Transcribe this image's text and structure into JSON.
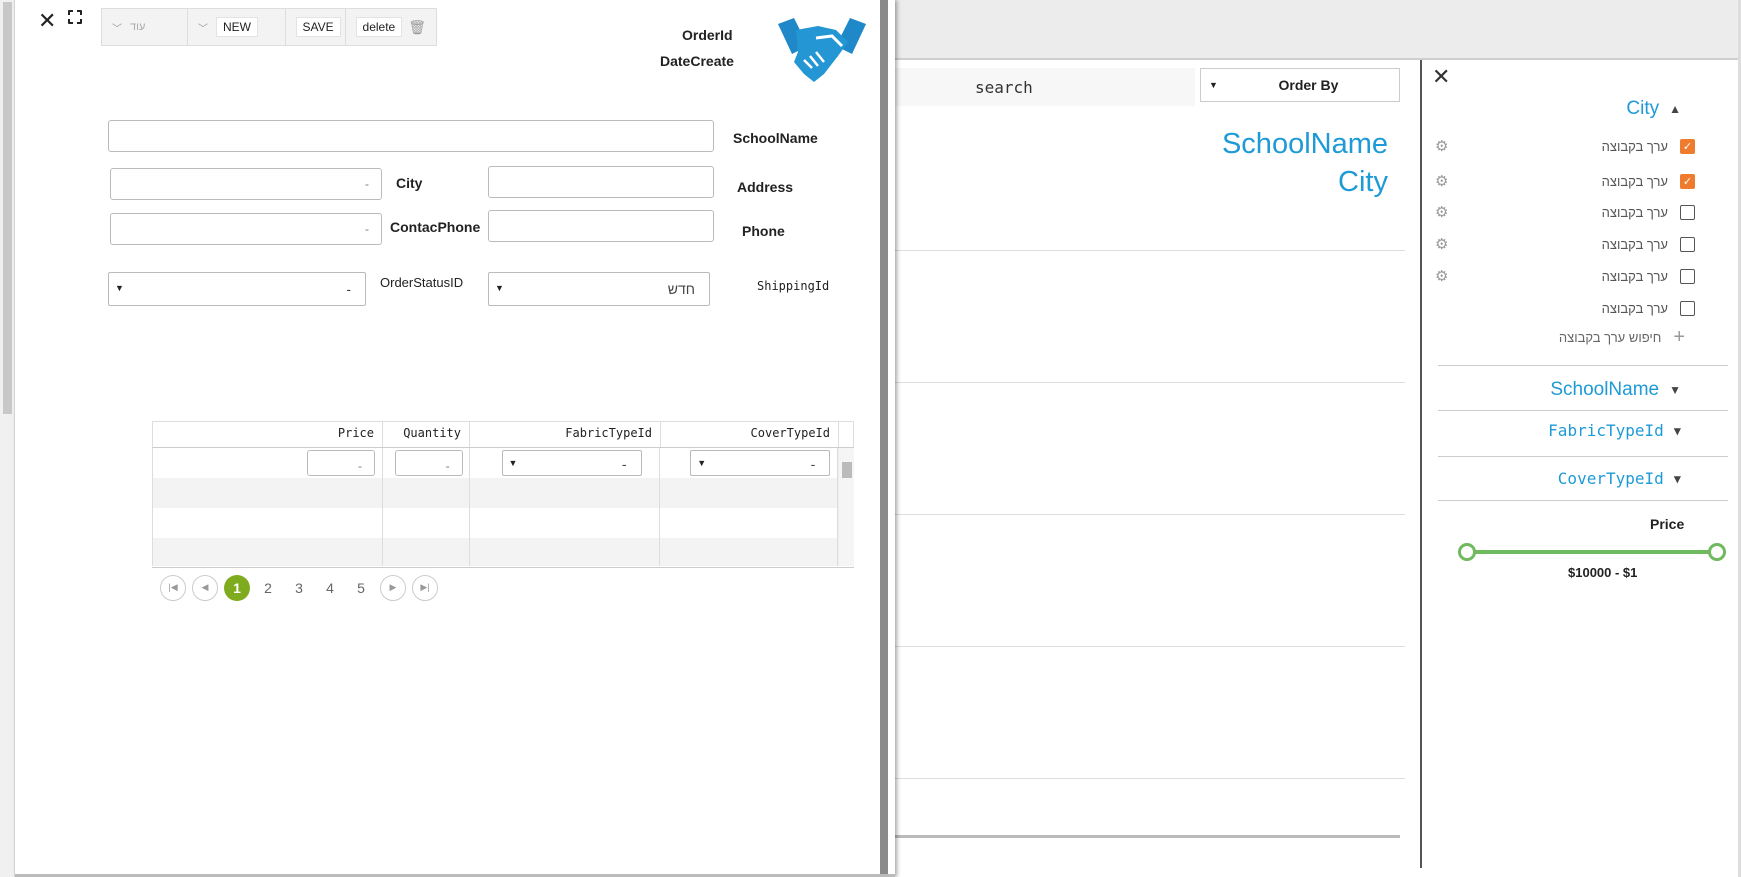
{
  "modal": {
    "toolbar": {
      "more_label": "עוד",
      "new_label": "NEW",
      "save_label": "SAVE",
      "delete_label": "delete"
    },
    "header": {
      "order_id_label": "OrderId",
      "date_create_label": "DateCreate"
    },
    "form": {
      "school_name_label": "SchoolName",
      "city_label": "City",
      "address_label": "Address",
      "contact_phone_label": "ContacPhone",
      "phone_label": "Phone",
      "order_status_label": "OrderStatusID",
      "shipping_label": "ShippingId",
      "city_value": "-",
      "contact_phone_value": "-",
      "order_status_value": "-",
      "shipping_value": "חדש"
    },
    "grid": {
      "columns": [
        "Price",
        "Quantity",
        "FabricTypeId",
        "CoverTypeId"
      ],
      "filter_placeholder": "-"
    },
    "pager": {
      "pages": [
        "1",
        "2",
        "3",
        "4",
        "5"
      ],
      "active_page": 1
    }
  },
  "list": {
    "search_label": "search",
    "order_by_label": "Order By",
    "card_title": "SchoolName",
    "card_subtitle": "City"
  },
  "filter_panel": {
    "city_header": "City",
    "group_items": [
      {
        "label": "ערך בקבוצה",
        "checked": true
      },
      {
        "label": "ערך בקבוצה",
        "checked": true
      },
      {
        "label": "ערך בקבוצה",
        "checked": false
      },
      {
        "label": "ערך בקבוצה",
        "checked": false
      },
      {
        "label": "ערך בקבוצה",
        "checked": false
      },
      {
        "label": "ערך בקבוצה",
        "checked": false
      }
    ],
    "add_group_label": "חיפוש ערך בקבוצה",
    "school_name_header": "SchoolName",
    "fabric_header": "FabricTypeId",
    "cover_header": "CoverTypeId",
    "price_header": "Price",
    "price_range": "$10000 - $1",
    "accent_color": "#1e9ad6",
    "check_color": "#ef7b2e",
    "slider_color": "#6fb95f"
  }
}
